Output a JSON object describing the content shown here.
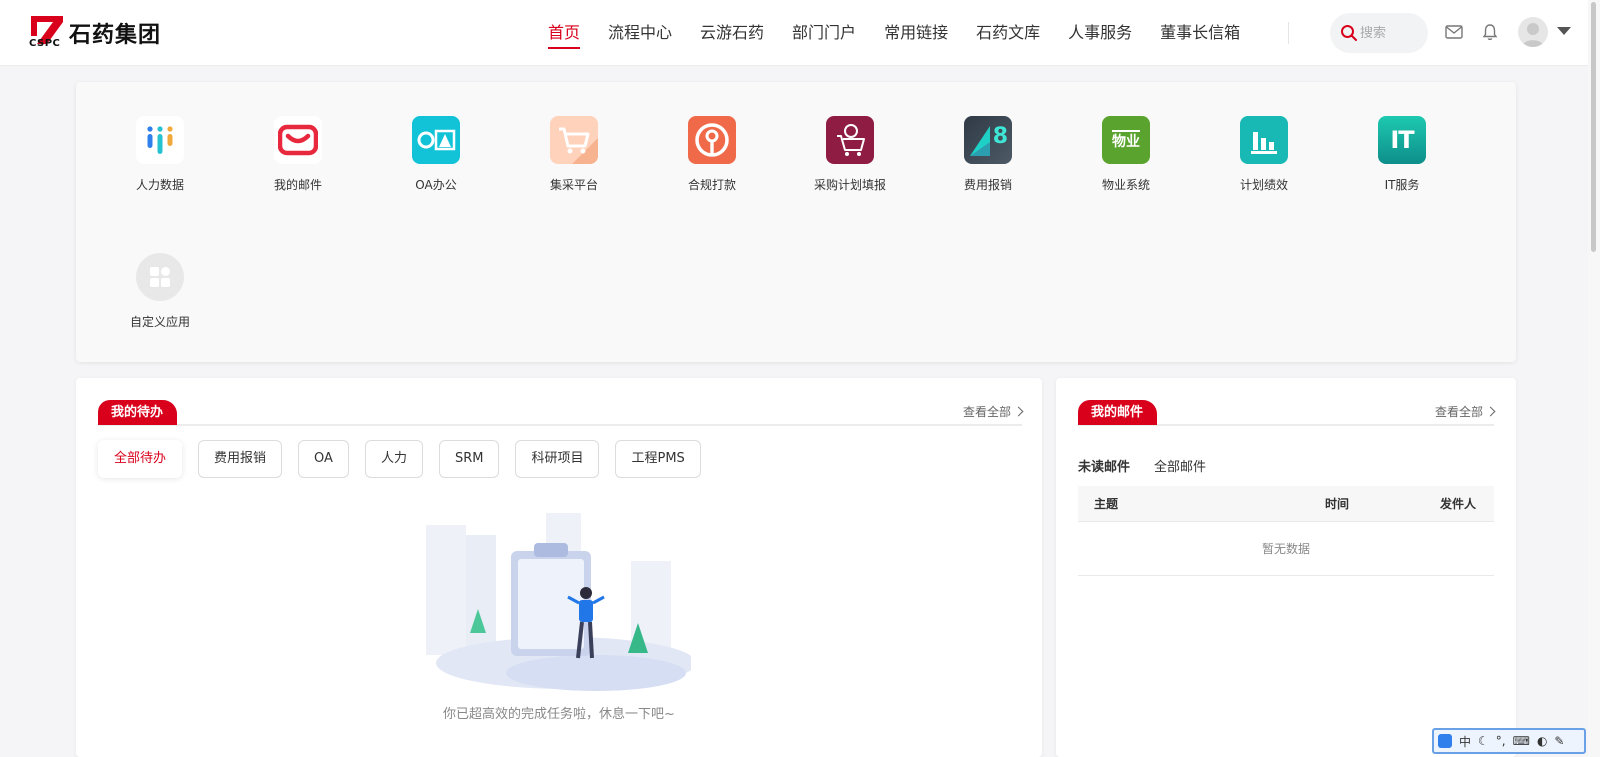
{
  "header": {
    "logo_cspc": "CSPC",
    "logo_text": "石药集团",
    "nav": [
      {
        "label": "首页",
        "active": true
      },
      {
        "label": "流程中心"
      },
      {
        "label": "云游石药"
      },
      {
        "label": "部门门户"
      },
      {
        "label": "常用链接"
      },
      {
        "label": "石药文库"
      },
      {
        "label": "人事服务"
      },
      {
        "label": "董事长信箱"
      }
    ],
    "search_placeholder": "搜索"
  },
  "apps": [
    {
      "label": "人力数据",
      "icon": "hr-data-icon"
    },
    {
      "label": "我的邮件",
      "icon": "mail-icon"
    },
    {
      "label": "OA办公",
      "icon": "oa-icon"
    },
    {
      "label": "集采平台",
      "icon": "cart-icon"
    },
    {
      "label": "合规打款",
      "icon": "payment-icon"
    },
    {
      "label": "采购计划填报",
      "icon": "purchase-plan-icon"
    },
    {
      "label": "费用报销",
      "icon": "expense-icon",
      "badge": "8"
    },
    {
      "label": "物业系统",
      "icon": "property-icon",
      "text": "物业"
    },
    {
      "label": "计划绩效",
      "icon": "performance-icon"
    },
    {
      "label": "IT服务",
      "icon": "it-icon",
      "text": "IT"
    },
    {
      "label": "自定义应用",
      "icon": "custom-app-icon"
    }
  ],
  "todo": {
    "title": "我的待办",
    "view_all": "查看全部",
    "filters": [
      "全部待办",
      "费用报销",
      "OA",
      "人力",
      "SRM",
      "科研项目",
      "工程PMS"
    ],
    "active_filter": 0,
    "empty_text": "你已超高效的完成任务啦，休息一下吧~"
  },
  "mail": {
    "title": "我的邮件",
    "view_all": "查看全部",
    "tabs": [
      "未读邮件",
      "全部邮件"
    ],
    "columns": [
      "主题",
      "时间",
      "发件人"
    ],
    "empty_text": "暂无数据"
  },
  "ime": {
    "mode": "中"
  },
  "colors": {
    "brand": "#d9001b"
  }
}
